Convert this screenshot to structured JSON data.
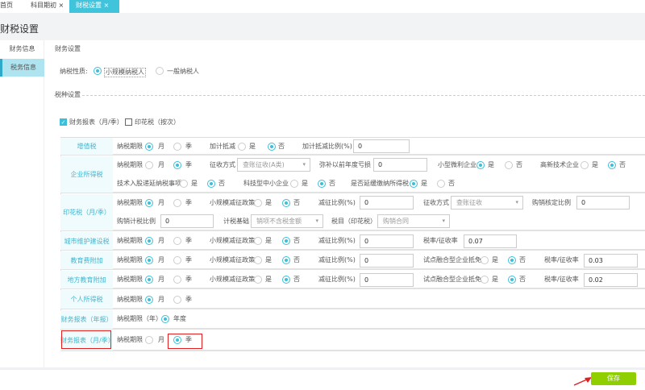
{
  "tabs": [
    {
      "label": "首页"
    },
    {
      "label": "科目期初",
      "close": "×"
    },
    {
      "label": "财税设置",
      "close": "×"
    }
  ],
  "page_title": "财税设置",
  "sidebar": [
    "财务信息",
    "税务信息"
  ],
  "finance_section": "财务设置",
  "taxpayer": {
    "label": "纳税性质:",
    "options": [
      "小规模纳税人",
      "一般纳税人"
    ],
    "selected": "小规模纳税人"
  },
  "tax_section": "税种设置",
  "checkboxes": [
    {
      "label": "财务报表（月/季）",
      "checked": true
    },
    {
      "label": "印花税（按次）",
      "checked": false
    }
  ],
  "common": {
    "period": "纳税期限",
    "month": "月",
    "quarter": "季",
    "yes": "是",
    "no": "否",
    "small_policy": "小规模减征政策",
    "reduce_ratio": "减征比例(%)",
    "rate": "税率/征收率",
    "pilot": "试点融合型企业抵免"
  },
  "vat": {
    "label": "增值税",
    "add_deduct": "加计抵减",
    "add_ratio_label": "加计抵减比例(%)",
    "add_ratio": "0"
  },
  "cit": {
    "label": "企业所得税",
    "collect_label": "征收方式",
    "collect_value": "查账征收(A类)",
    "loss_label": "弥补以前年度亏损",
    "loss_value": "0",
    "small_profit": "小型微利企业",
    "high_tech": "高新技术企业",
    "tech_share": "技术入股递延纳税事项",
    "sci_sme": "科技型中小企业",
    "defer": "是否延缓缴纳所得税"
  },
  "stamp": {
    "label": "印花税（月/季）",
    "reduce_value": "0",
    "collect_label": "征收方式",
    "collect_value": "查账征收",
    "purchase_fixed_label": "购销核定比例",
    "purchase_fixed": "0",
    "purchase_ratio_label": "购销计税比例",
    "purchase_ratio": "0",
    "base_label": "计税基础",
    "base_value": "销项不含税金额",
    "item_label": "税目（印花税）",
    "item_value": "购销合同"
  },
  "urban": {
    "label": "城市维护建设税",
    "reduce_value": "0",
    "rate": "0.07"
  },
  "edu": {
    "label": "教育费附加",
    "reduce_value": "0",
    "rate": "0.03"
  },
  "local_edu": {
    "label": "地方教育附加",
    "reduce_value": "0",
    "rate": "0.02"
  },
  "pit": {
    "label": "个人所得税"
  },
  "annual": {
    "label": "财务报表（年报）",
    "period": "纳税期限（年）",
    "option": "年度"
  },
  "monthly": {
    "label": "财务报表（月/季）"
  },
  "save": "保存",
  "colors": {
    "accent": "#40c4dc",
    "save": "#8fcf00",
    "highlight": "#e02020"
  }
}
